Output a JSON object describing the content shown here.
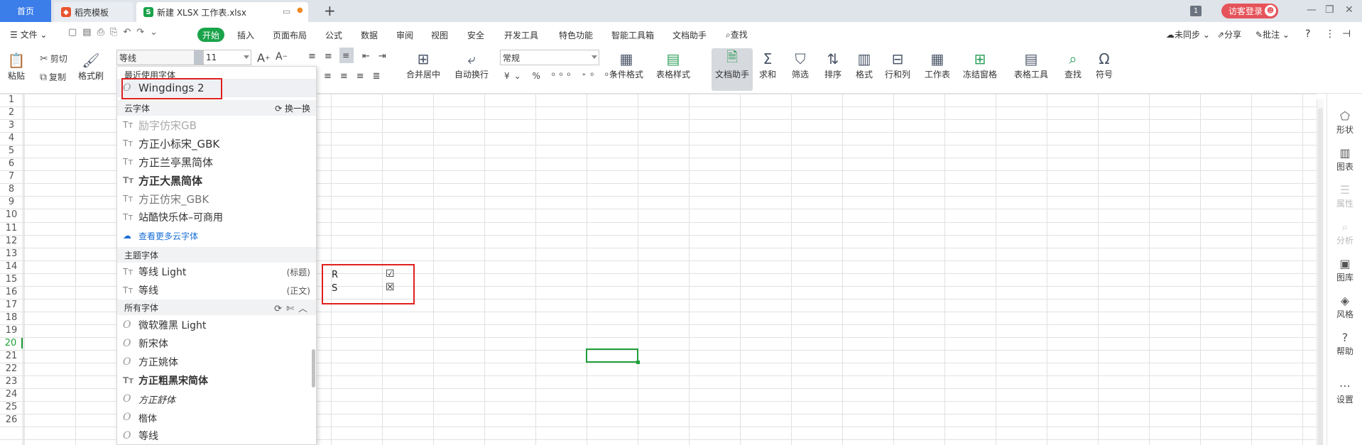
{
  "titlebar": {
    "tabs": [
      {
        "label": "首页"
      },
      {
        "label": "稻壳模板"
      },
      {
        "label": "新建 XLSX 工作表.xlsx"
      }
    ],
    "add_tab": "+",
    "badge": "1",
    "login_label": "访客登录"
  },
  "menubar": {
    "file": "文件",
    "items": [
      "开始",
      "插入",
      "页面布局",
      "公式",
      "数据",
      "审阅",
      "视图",
      "安全",
      "开发工具",
      "特色功能",
      "智能工具箱",
      "文档助手"
    ],
    "search": "查找",
    "sync": "未同步",
    "share": "分享",
    "comment": "批注"
  },
  "ribbon": {
    "paste": "粘贴",
    "cut": "剪切",
    "copy": "复制",
    "format_painter": "格式刷",
    "font_name": "等线",
    "font_size": "11",
    "merge_center": "合并居中",
    "wrap_text": "自动换行",
    "number_format": "常规",
    "cond_format": "条件格式",
    "table_style": "表格样式",
    "doc_helper": "文档助手",
    "sum": "求和",
    "filter": "筛选",
    "sort": "排序",
    "format": "格式",
    "row_col": "行和列",
    "worksheet": "工作表",
    "freeze": "冻结窗格",
    "table_tools": "表格工具",
    "find": "查找",
    "symbol": "符号"
  },
  "font_dropdown": {
    "recent_header": "最近使用字体",
    "recent_fonts": [
      "Wingdings 2"
    ],
    "cloud_header": "云字体",
    "switch_label": "换一换",
    "cloud_fonts": [
      "励字仿宋GB",
      "方正小标宋_GBK",
      "方正兰亭黑简体",
      "方正大黑简体",
      "方正仿宋_GBK",
      "站酷快乐体–可商用"
    ],
    "more_cloud": "查看更多云字体",
    "theme_header": "主题字体",
    "theme_fonts": [
      {
        "name": "等线 Light",
        "tag": "(标题)"
      },
      {
        "name": "等线",
        "tag": "(正文)"
      }
    ],
    "all_header": "所有字体",
    "all_fonts": [
      "微软雅黑 Light",
      "新宋体",
      "方正姚体",
      "方正粗黑宋简体",
      "方正舒体",
      "楷体",
      "等线"
    ]
  },
  "grid": {
    "row_numbers": [
      "1",
      "2",
      "3",
      "4",
      "5",
      "6",
      "7",
      "8",
      "9",
      "10",
      "11",
      "12",
      "13",
      "14",
      "15",
      "16",
      "17",
      "18",
      "19",
      "20",
      "21",
      "22",
      "23",
      "24",
      "25",
      "26"
    ],
    "active_row": "20",
    "cells": [
      {
        "text": "R",
        "symbol": "☑"
      },
      {
        "text": "S",
        "symbol": "☒"
      }
    ]
  },
  "sidebar": {
    "items": [
      "形状",
      "图表",
      "属性",
      "分析",
      "图库",
      "风格",
      "帮助",
      "设置"
    ]
  },
  "colors": {
    "accent": "#1aa34a",
    "tab_blue": "#3b7de9",
    "highlight": "#e02020",
    "login": "#e5545a"
  }
}
